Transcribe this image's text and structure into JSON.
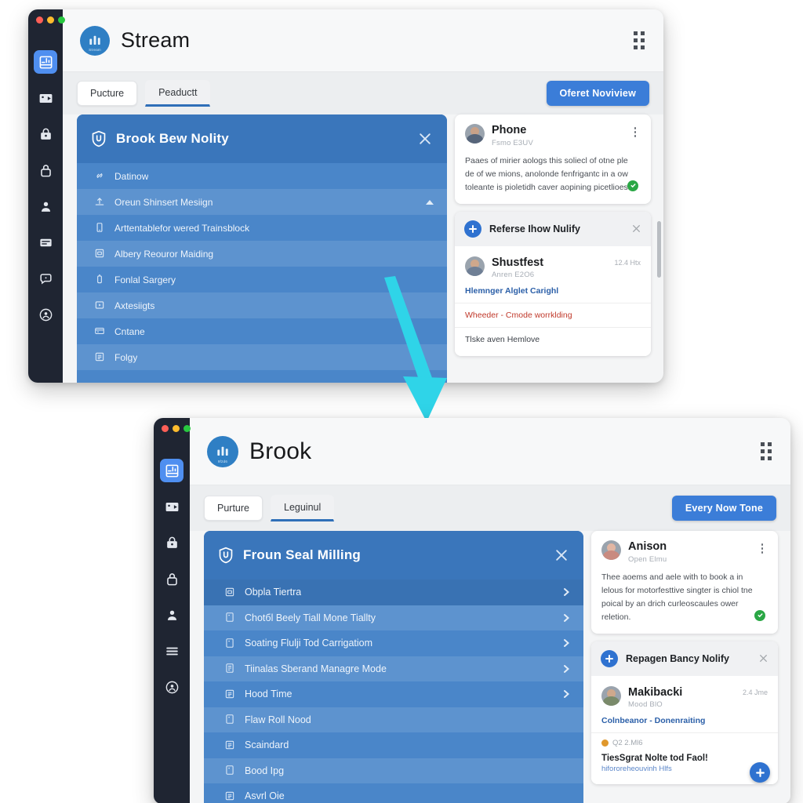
{
  "windows": {
    "top": {
      "logo": {
        "mark": "bar-chart-mark",
        "caption": "Stream"
      },
      "title": "Stream",
      "grip": "grid-dots-icon",
      "tabs": [
        {
          "label": "Pucture",
          "selected": false
        },
        {
          "label": "Peaductt",
          "selected": true
        }
      ],
      "cta": "Oferet Noviview",
      "panel": {
        "title": "Brook Bew Nolity",
        "close": "close-icon",
        "rows": [
          {
            "label": "Datinow",
            "icon": "link-icon",
            "chevron": "",
            "style": "plain"
          },
          {
            "label": "Oreun Shinsert Mesiign",
            "icon": "upload-icon",
            "chevron": "caret-up",
            "style": "alt"
          },
          {
            "label": "Arttentablefor wered Trainsblock",
            "icon": "mobile-icon",
            "chevron": "",
            "style": "plain"
          },
          {
            "label": "Albery Reouror Maiding",
            "icon": "card-icon",
            "chevron": "",
            "style": "alt"
          },
          {
            "label": "Fonlal Sargery",
            "icon": "battery-icon",
            "chevron": "",
            "style": "plain"
          },
          {
            "label": "Axtesiigts",
            "icon": "media-icon",
            "chevron": "",
            "style": "alt"
          },
          {
            "label": "Cntane",
            "icon": "wallet-icon",
            "chevron": "",
            "style": "plain"
          },
          {
            "label": "Folgy",
            "icon": "list-icon",
            "chevron": "",
            "style": "alt"
          }
        ]
      },
      "person_card": {
        "name": "Phone",
        "subtitle": "Fsmo E3UV",
        "body": "Paaes of mirier aologs this soliecl of otne ple de of we mions, anolonde fenfrigantc in a ow toleante is pioletidh caver aopining picetlioes.",
        "verified": "check-icon",
        "menu": "kebab-icon"
      },
      "notify": {
        "title": "Referse Ihow Nulify",
        "add": "plus-icon",
        "close": "close-icon",
        "entry": {
          "name": "Shustfest",
          "subtitle": "Anren E2O6",
          "time": "12.4 Htx",
          "lines": [
            {
              "text": "Hlemnger Alglet Carighl",
              "style": "link"
            },
            {
              "text": "Wheeder - Cmode worrklding",
              "style": "alert"
            },
            {
              "text": "Tlske aven Hemlove",
              "style": "plain"
            }
          ]
        }
      }
    },
    "bottom": {
      "logo": {
        "mark": "bar-chart-mark",
        "caption": "9f2d6"
      },
      "title": "Brook",
      "grip": "grid-dots-icon",
      "tabs": [
        {
          "label": "Purture",
          "selected": false
        },
        {
          "label": "Leguinul",
          "selected": true
        }
      ],
      "cta": "Every Now Tone",
      "panel": {
        "title": "Froun Seal Milling",
        "close": "close-icon",
        "rows": [
          {
            "label": "Obpla Tiertra",
            "icon": "card-icon",
            "chevron": "chevron-right",
            "style": "hl"
          },
          {
            "label": "Chotбl Beely Tiall Mone Tiallty",
            "icon": "doc-icon",
            "chevron": "chevron-right",
            "style": "alt"
          },
          {
            "label": "Soating Flulji Tod Carrigatiom",
            "icon": "doc-icon",
            "chevron": "chevron-right",
            "style": "plain"
          },
          {
            "label": "Tiinalas Sberand Managre Mode",
            "icon": "list-icon",
            "chevron": "chevron-right",
            "style": "alt"
          },
          {
            "label": "Hood Time",
            "icon": "list-icon",
            "chevron": "chevron-right",
            "style": "plain"
          },
          {
            "label": "Flaw Roll Nood",
            "icon": "doc-icon",
            "chevron": "",
            "style": "alt"
          },
          {
            "label": "Scaindard",
            "icon": "list-icon",
            "chevron": "",
            "style": "plain"
          },
          {
            "label": "Bood Ipg",
            "icon": "doc-icon",
            "chevron": "",
            "style": "alt"
          },
          {
            "label": "Asvrl Oie",
            "icon": "list-icon",
            "chevron": "",
            "style": "plain"
          }
        ]
      },
      "person_card": {
        "name": "Anison",
        "subtitle": "Open Elmu",
        "body": "Thee aoems and aele with to book a in lelous for motorfesttive singter is chiol tne poical by an drich curleoscaules ower reletion.",
        "verified": "check-icon",
        "menu": "kebab-icon"
      },
      "notify": {
        "title": "Repagen Bancy Nolify",
        "add": "plus-icon",
        "close": "close-icon",
        "entry": {
          "name": "Makibacki",
          "subtitle": "Mood BlO",
          "time": "2.4 Jme",
          "lines": [
            {
              "text": "Colnbeanor - Donenraiting",
              "style": "link"
            }
          ],
          "amber_note": "Q2 2.Ml6",
          "headline": "TiesSgrat Nolte tod Faol!",
          "url": "hifororeheouvinh Hlfs",
          "fab": "plus-icon"
        }
      }
    }
  },
  "rail": {
    "items": [
      {
        "name": "dashboard-icon",
        "active": true
      },
      {
        "name": "image-export-icon",
        "active": false
      },
      {
        "name": "lock-box-icon",
        "active": false
      },
      {
        "name": "padlock-icon",
        "active": false
      },
      {
        "name": "user-icon",
        "active": false
      },
      {
        "name": "panel-icon",
        "active": false
      },
      {
        "name": "chat-icon",
        "active": false
      },
      {
        "name": "account-circle-icon",
        "active": false
      }
    ],
    "items_bottom": [
      {
        "name": "dashboard-icon",
        "active": true
      },
      {
        "name": "image-export-icon",
        "active": false
      },
      {
        "name": "lock-box-icon",
        "active": false
      },
      {
        "name": "padlock-icon",
        "active": false
      },
      {
        "name": "user-icon",
        "active": false
      },
      {
        "name": "menu-lines-icon",
        "active": false
      },
      {
        "name": "account-circle-icon",
        "active": false
      }
    ]
  },
  "annotation": {
    "arrow": "down-arrow-annotation",
    "color": "#2fd4e8"
  },
  "colors": {
    "accent": "#3b7dd8",
    "panel_blue": "#4a86c9",
    "panel_head_blue": "#3a76bb",
    "rail_dark": "#1f2532",
    "arrow_cyan": "#2fd4e8",
    "alert_red": "#c0392b",
    "verified_green": "#2aa745",
    "amber": "#e0982c"
  }
}
